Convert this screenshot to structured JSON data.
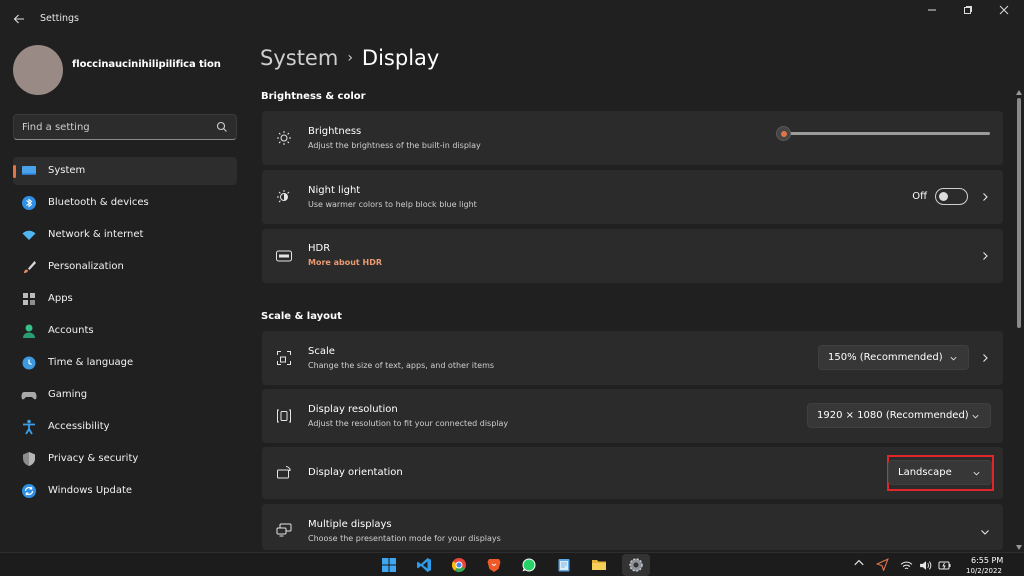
{
  "window": {
    "title": "Settings",
    "back_icon": "back-arrow-icon",
    "controls": [
      "minimize-icon",
      "restore-icon",
      "close-icon"
    ]
  },
  "profile": {
    "name": "floccinaucinihilipilifica tion"
  },
  "search": {
    "placeholder": "Find a setting",
    "icon": "search-icon"
  },
  "sidebar": {
    "items": [
      {
        "label": "System",
        "icon": "system-icon",
        "active": true
      },
      {
        "label": "Bluetooth & devices",
        "icon": "bluetooth-icon"
      },
      {
        "label": "Network & internet",
        "icon": "wifi-icon"
      },
      {
        "label": "Personalization",
        "icon": "brush-icon"
      },
      {
        "label": "Apps",
        "icon": "apps-icon"
      },
      {
        "label": "Accounts",
        "icon": "person-icon"
      },
      {
        "label": "Time & language",
        "icon": "globe-clock-icon"
      },
      {
        "label": "Gaming",
        "icon": "gamepad-icon"
      },
      {
        "label": "Accessibility",
        "icon": "accessibility-icon"
      },
      {
        "label": "Privacy & security",
        "icon": "shield-icon"
      },
      {
        "label": "Windows Update",
        "icon": "update-icon"
      }
    ]
  },
  "main": {
    "breadcrumb": {
      "parent": "System",
      "separator": "›",
      "current": "Display"
    },
    "sections": {
      "brightness_color": "Brightness & color",
      "scale_layout": "Scale & layout"
    },
    "brightness": {
      "title": "Brightness",
      "desc": "Adjust the brightness of the built-in display",
      "value_fraction": 0.0,
      "icon": "sun-icon"
    },
    "night_light": {
      "title": "Night light",
      "desc": "Use warmer colors to help block blue light",
      "toggle_label": "Off",
      "toggle_on": false,
      "icon": "night-light-icon"
    },
    "hdr": {
      "title": "HDR",
      "link": "More about HDR",
      "icon": "hdr-icon"
    },
    "scale": {
      "title": "Scale",
      "desc": "Change the size of text, apps, and other items",
      "value": "150% (Recommended)",
      "icon": "scale-icon"
    },
    "resolution": {
      "title": "Display resolution",
      "desc": "Adjust the resolution to fit your connected display",
      "value": "1920 × 1080 (Recommended)",
      "icon": "resolution-icon"
    },
    "orientation": {
      "title": "Display orientation",
      "value": "Landscape",
      "icon": "orientation-icon"
    },
    "multiple": {
      "title": "Multiple displays",
      "desc": "Choose the presentation mode for your displays",
      "icon": "multiple-displays-icon"
    }
  },
  "taskbar": {
    "apps": [
      "windows-start-icon",
      "vscode-icon",
      "chrome-icon",
      "brave-icon",
      "whatsapp-icon",
      "notepad-icon",
      "file-explorer-icon",
      "settings-icon"
    ],
    "tray": [
      "chevron-up-icon",
      "location-icon",
      "wifi-icon",
      "volume-icon",
      "battery-icon"
    ],
    "time": "6:55 PM",
    "date": "10/2/2022"
  },
  "colors": {
    "accent": "#e0754a",
    "link": "#e99a72",
    "highlight": "#e0262b",
    "background": "#202020",
    "card": "#2b2b2b"
  }
}
